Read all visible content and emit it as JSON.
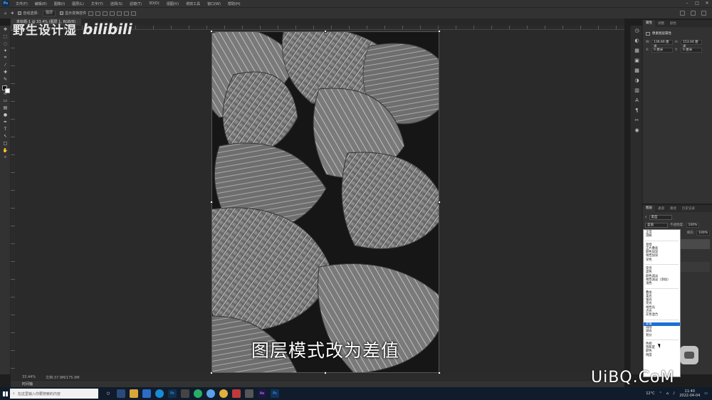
{
  "app": {
    "logo": "Ps",
    "document_tab": "未标题-1 @ 33.4% (图层 1, RGB/8)"
  },
  "menu": [
    "文件(F)",
    "编辑(E)",
    "图像(I)",
    "图层(L)",
    "文字(Y)",
    "选择(S)",
    "滤镜(T)",
    "3D(D)",
    "视图(V)",
    "增效工具",
    "窗口(W)",
    "帮助(H)"
  ],
  "options": {
    "auto_select_label": "自动选择:",
    "auto_select_value": "图层",
    "transform_label": "显示变换控件"
  },
  "watermark": {
    "text": "野生设计湿",
    "logo": "bilibili"
  },
  "subtitle": "图层模式改为差值",
  "status": {
    "zoom": "33.44%",
    "doc": "文档:37.9M/175.9M"
  },
  "timeline_label": "时间轴",
  "properties": {
    "tabs": [
      "属性",
      "调整",
      "颜色"
    ],
    "title": "像素图层属性",
    "w_label": "W:",
    "w_value": "136.66 厘米",
    "h_label": "H:",
    "h_value": "153.04 厘米",
    "x_label": "X:",
    "x_value": "0 厘米",
    "y_label": "Y:",
    "y_value": "0 厘米"
  },
  "layers": {
    "tabs": [
      "图层",
      "通道",
      "路径",
      "历史记录"
    ],
    "kind": "类型",
    "blend_selected": "差值",
    "opacity_label": "不透明度:",
    "opacity_value": "100%",
    "fill_label": "填充:",
    "fill_value": "100%"
  },
  "blend_modes": [
    [
      "正常",
      "溶解"
    ],
    [
      "变暗",
      "正片叠底",
      "颜色加深",
      "线性加深",
      "深色"
    ],
    [
      "变亮",
      "滤色",
      "颜色减淡",
      "线性减淡（添加）",
      "浅色"
    ],
    [
      "叠加",
      "柔光",
      "强光",
      "亮光",
      "线性光",
      "点光",
      "实色混合"
    ],
    [
      "差值",
      "排除",
      "减去",
      "划分"
    ],
    [
      "色相",
      "饱和度",
      "颜色",
      "明度"
    ]
  ],
  "overlay_brand": "UiBQ.CoM",
  "taskbar": {
    "search_placeholder": "在这里输入你要搜索的内容",
    "weather": "12°C",
    "time": "11:40",
    "date": "2022-04-04"
  },
  "colors": {
    "highlight": "#1e6fd4",
    "taskbar": "#101c2c"
  }
}
